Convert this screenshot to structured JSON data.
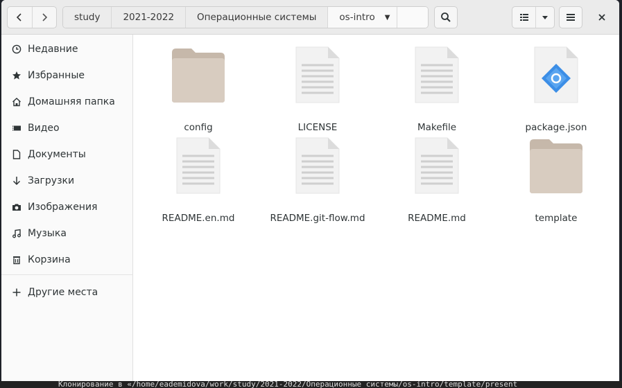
{
  "pathbar": {
    "crumbs": [
      "study",
      "2021-2022",
      "Операционные системы",
      "os-intro"
    ]
  },
  "sidebar": {
    "items": [
      {
        "label": "Недавние",
        "icon": "clock-icon"
      },
      {
        "label": "Избранные",
        "icon": "star-icon"
      },
      {
        "label": "Домашняя папка",
        "icon": "home-icon"
      },
      {
        "label": "Видео",
        "icon": "video-icon"
      },
      {
        "label": "Документы",
        "icon": "document-icon"
      },
      {
        "label": "Загрузки",
        "icon": "download-icon"
      },
      {
        "label": "Изображения",
        "icon": "camera-icon"
      },
      {
        "label": "Музыка",
        "icon": "music-icon"
      },
      {
        "label": "Корзина",
        "icon": "trash-icon"
      }
    ],
    "other_places": "Другие места"
  },
  "files": [
    {
      "name": "config",
      "kind": "folder"
    },
    {
      "name": "LICENSE",
      "kind": "text"
    },
    {
      "name": "Makefile",
      "kind": "text"
    },
    {
      "name": "package.json",
      "kind": "json"
    },
    {
      "name": "README.en.md",
      "kind": "text"
    },
    {
      "name": "README.git-flow.md",
      "kind": "text"
    },
    {
      "name": "README.md",
      "kind": "text"
    },
    {
      "name": "template",
      "kind": "folder"
    }
  ],
  "terminal": {
    "text": "Клонирование в «/home/eademidova/work/study/2021-2022/Операционные системы/os-intro/template/present"
  },
  "colors": {
    "folder": "#d8ccc0",
    "folder_tab": "#c6b8aa",
    "json_accent": "#3c8ee6"
  }
}
